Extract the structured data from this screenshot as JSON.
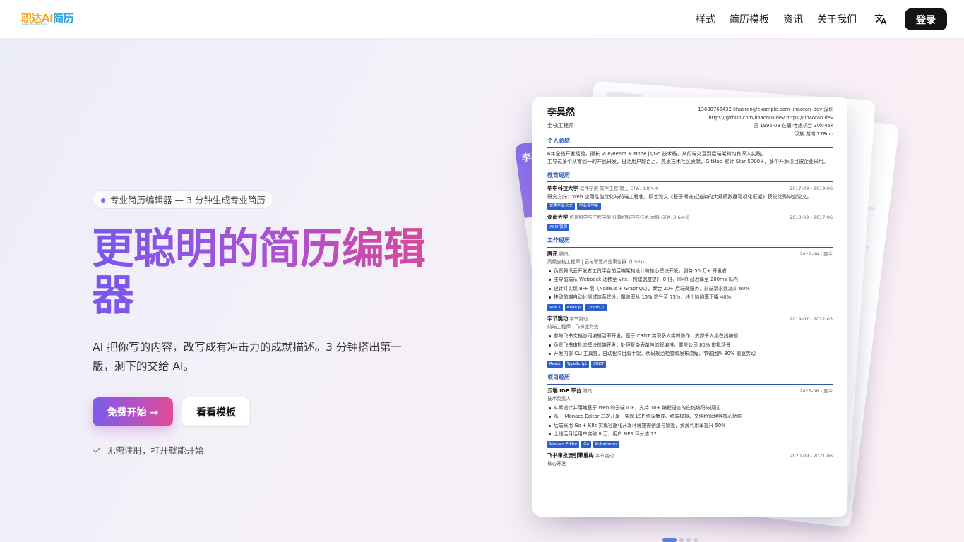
{
  "header": {
    "logo_text_a": "职达AI",
    "logo_text_b": "简历",
    "logo_sub": "www.zhidaai.com",
    "nav": [
      "样式",
      "简历模板",
      "资讯",
      "关于我们"
    ],
    "login": "登录"
  },
  "hero": {
    "badge": "专业简历编辑器 — 3 分钟生成专业简历",
    "title": "更聪明的简历编辑器",
    "description": "AI 把你写的内容，改写成有冲击力的成就描述。3 分钟搭出第一版，剩下的交给 AI。",
    "cta_primary": "免费开始 →",
    "cta_secondary": "看看模板",
    "note": "无需注册，打开就能开始"
  },
  "back_card": {
    "name": "李昊"
  },
  "resume": {
    "name": "李昊然",
    "role": "全栈工程师",
    "contact": [
      "13698765432    lihaoran@example.com    lihaoran_dev    深圳",
      "https://github.com/lihaoran-dev    https://lihaoran.dev",
      "男    1995-03    在职-考虑机会    30k-45k",
      "汉族    湖南    178cm"
    ],
    "summary": {
      "title": "个人总结",
      "p1": "6年全栈开发经验，擅长 Vue/React + Node.js/Go 技术栈，从前端交互到后端架构均有深入实践。",
      "p2": "主导过多个从零到一的产品研发，日活用户超百万。热衷技术社区贡献，GitHub 累计 Star 5000+，多个开源项目被企业采用。"
    },
    "education": {
      "title": "教育经历",
      "items": [
        {
          "org": "华中科技大学",
          "meta": "软件学院   软件工程   硕士   GPA: 3.8/4.0",
          "date": "2017-09 - 2019-06",
          "desc": "研究方向：Web 应用性能优化与前端工程化。硕士论文《基于渐进式渲染的大规模数据可视化框架》获校优秀毕业论文。",
          "tags": [
            "优秀毕业论文",
            "学业奖学金"
          ]
        },
        {
          "org": "湖南大学",
          "meta": "信息科学与工程学院   计算机科学与技术   本科   GPA: 3.6/4.0",
          "date": "2013-09 - 2017-06",
          "desc": "",
          "tags": [
            "ACM 银牌"
          ]
        }
      ]
    },
    "work": {
      "title": "工作经历",
      "items": [
        {
          "org": "腾讯",
          "meta": "腾讯",
          "date": "2022-04 - 至今",
          "sub": "高级全栈工程师  |  云与智慧产业事业群（CSIG）",
          "bullets": [
            "负责腾讯云开发者工具平台前后端架构设计与核心模块开发，服务 50 万+ 开发者",
            "主导前端从 Webpack 迁移至 Vite，构建速度提升 8 倍，HMR 延迟降至 200ms 以内",
            "设计并实现 BFF 层（Node.js + GraphQL），聚合 20+ 后端微服务，前端请求数减少 60%",
            "推动前端自动化测试体系建设，覆盖率从 15% 提升至 75%，线上缺陷率下降 40%"
          ],
          "tags": [
            "Vue 3",
            "Node.js",
            "GraphQL"
          ]
        },
        {
          "org": "字节跳动",
          "meta": "字节跳动",
          "date": "2019-07 - 2022-03",
          "sub": "前端工程师  |  飞书业务线",
          "bullets": [
            "参与飞书文档协同编辑引擎开发，基于 CRDT 实现多人实时协作，支撑千人级在线编辑",
            "负责飞书审批流模块前端开发，处理复杂表单与流程编排，覆盖公司 80% 审批场景",
            "开发内部 CLI 工具链，自动化项目脚手架、代码规范检查和发布流程，节省团队 30% 重复劳动"
          ],
          "tags": [
            "React",
            "TypeScript",
            "CRDT"
          ]
        }
      ]
    },
    "projects": {
      "title": "项目经历",
      "items": [
        {
          "org": "云端 IDE 平台",
          "meta": "腾讯",
          "date": "2023-06 - 至今",
          "sub": "技术负责人",
          "bullets": [
            "从零设计并落地基于 Web 的云端 IDE，支持 10+ 编程语言的在线编码与调试",
            "基于 Monaco Editor 二次开发，实现 LSP 协议集成、终端模拟、文件树管理等核心功能",
            "后端采用 Go + K8s 实现容器化开发环境按需创建与销毁，资源利用率提升 50%",
            "上线后月活用户突破 8 万，用户 NPS 评分达 72"
          ],
          "tags": [
            "Monaco Editor",
            "Go",
            "Kubernetes"
          ]
        },
        {
          "org": "飞书审批流引擎重构",
          "meta": "字节跳动",
          "date": "2020-09 - 2021-06",
          "sub": "核心开发",
          "bullets": [],
          "tags": []
        }
      ]
    }
  }
}
